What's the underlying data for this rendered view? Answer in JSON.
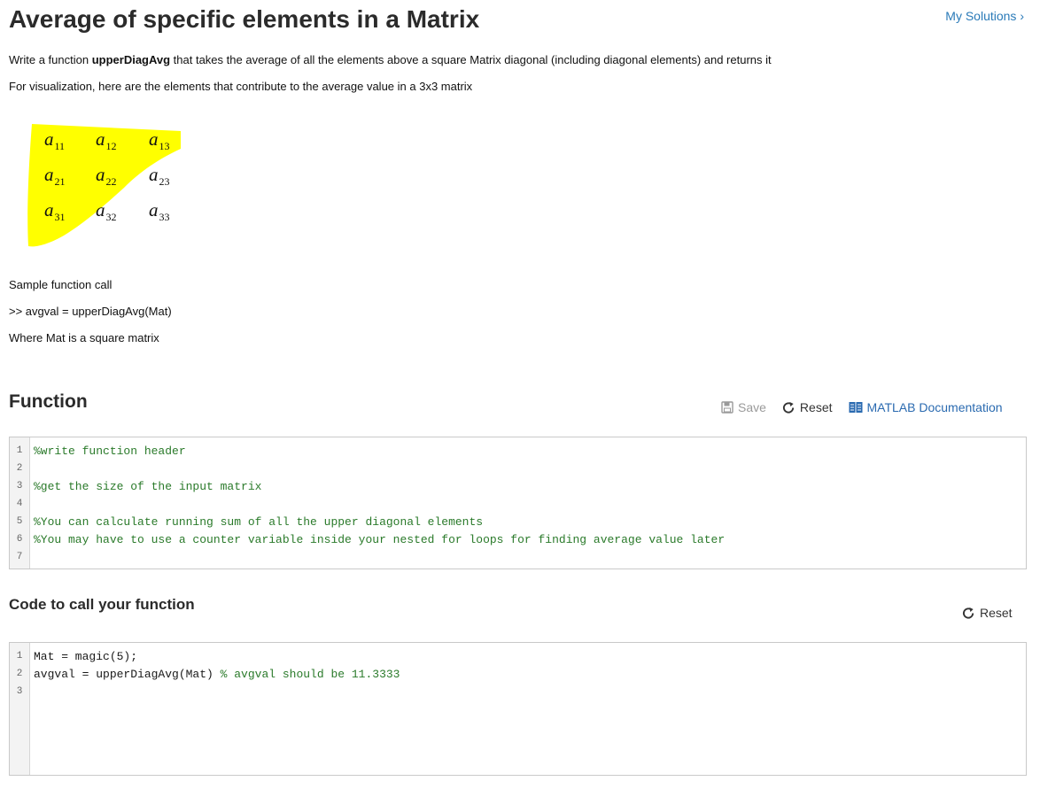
{
  "page": {
    "title": "Average of specific elements in a Matrix",
    "my_solutions": "My Solutions"
  },
  "problem": {
    "desc_prefix": "Write a function ",
    "function_name": "upperDiagAvg",
    "desc_suffix": " that takes the average of all the elements above a square Matrix diagonal (including diagonal elements) and returns it",
    "visualization": "For visualization, here are the elements that contribute to the average value in a 3x3 matrix",
    "sample_label": "Sample function call",
    "sample_call": ">> avgval = upperDiagAvg(Mat)",
    "where": "Where Mat is a square matrix"
  },
  "matrix_figure": {
    "highlight_color": "#ffff00",
    "rows": [
      [
        {
          "base": "a",
          "sub": "11"
        },
        {
          "base": "a",
          "sub": "12"
        },
        {
          "base": "a",
          "sub": "13"
        }
      ],
      [
        {
          "base": "a",
          "sub": "21"
        },
        {
          "base": "a",
          "sub": "22"
        },
        {
          "base": "a",
          "sub": "23"
        }
      ],
      [
        {
          "base": "a",
          "sub": "31"
        },
        {
          "base": "a",
          "sub": "32"
        },
        {
          "base": "a",
          "sub": "33"
        }
      ]
    ]
  },
  "function_section": {
    "title": "Function",
    "save": "Save",
    "reset": "Reset",
    "docs": "MATLAB Documentation",
    "lines": [
      {
        "num": "1",
        "text": "%write function header",
        "type": "comment"
      },
      {
        "num": "2",
        "text": "",
        "type": "code"
      },
      {
        "num": "3",
        "text": "%get the size of the input matrix",
        "type": "comment"
      },
      {
        "num": "4",
        "text": "",
        "type": "code"
      },
      {
        "num": "5",
        "text": "%You can calculate running sum of all the upper diagonal elements",
        "type": "comment"
      },
      {
        "num": "6",
        "text": "%You may have to use a counter variable inside your nested for loops for finding average value later",
        "type": "comment"
      },
      {
        "num": "7",
        "text": "",
        "type": "code"
      }
    ]
  },
  "call_section": {
    "title": "Code to call your function",
    "reset": "Reset",
    "lines": [
      {
        "num": "1",
        "code": "Mat = magic(5);",
        "comment": ""
      },
      {
        "num": "2",
        "code": "avgval = upperDiagAvg(Mat) ",
        "comment": "% avgval should be 11.3333"
      },
      {
        "num": "3",
        "code": "",
        "comment": ""
      }
    ]
  },
  "colors": {
    "link": "#2a7ab8",
    "comment": "#2a7a2a",
    "highlight": "#ffff00"
  }
}
